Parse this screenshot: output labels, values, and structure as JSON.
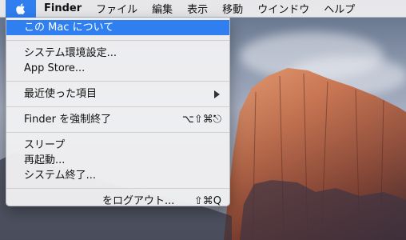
{
  "menubar": {
    "apple_icon": "apple-icon",
    "app_name": "Finder",
    "menus": [
      "ファイル",
      "編集",
      "表示",
      "移動",
      "ウインドウ",
      "ヘルプ"
    ]
  },
  "apple_menu": {
    "items": {
      "about": "この Mac について",
      "prefs": "システム環境設定...",
      "appstore": "App Store...",
      "recent": "最近使った項目",
      "forcequit": "Finder を強制終了",
      "forcequit_shortcut": "⌥⇧⌘⎋",
      "sleep": "スリープ",
      "restart": "再起動...",
      "shutdown": "システム終了...",
      "logout": "をログアウト...",
      "logout_shortcut": "⇧⌘Q"
    }
  },
  "colors": {
    "highlight": "#2f7ff0",
    "menu_bg": "#f0f0f2"
  }
}
